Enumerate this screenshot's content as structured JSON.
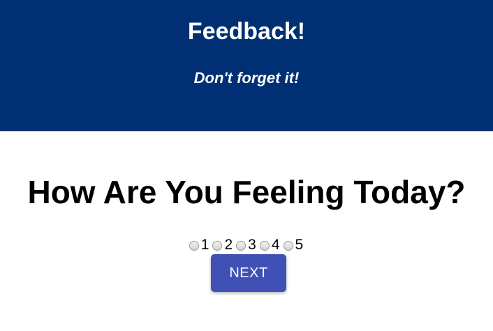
{
  "header": {
    "title": "Feedback!",
    "subtitle": "Don't forget it!",
    "background_color": "#003073"
  },
  "survey": {
    "question": "How Are You Feeling Today?",
    "options": [
      {
        "label": "1",
        "selected": false
      },
      {
        "label": "2",
        "selected": false
      },
      {
        "label": "3",
        "selected": false
      },
      {
        "label": "4",
        "selected": false
      },
      {
        "label": "5",
        "selected": false
      }
    ],
    "next_label": "NEXT",
    "button_color": "#3f51b5"
  }
}
